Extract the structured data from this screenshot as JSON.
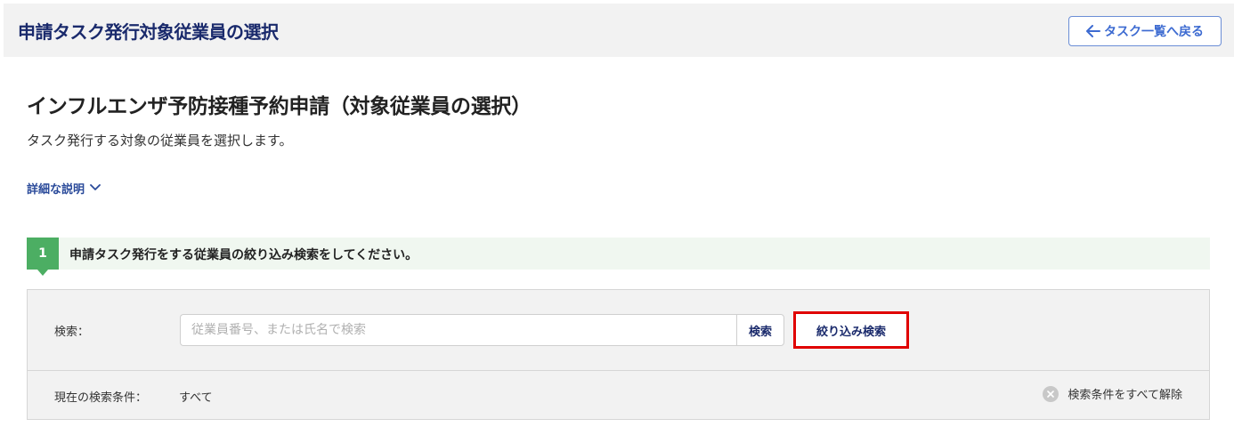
{
  "header": {
    "title": "申請タスク発行対象従業員の選択",
    "back_label": "タスク一覧へ戻る",
    "back_icon": "arrow-left-icon"
  },
  "main": {
    "title": "インフルエンザ予防接種予約申請（対象従業員の選択）",
    "description": "タスク発行する対象の従業員を選択します。",
    "detail_link": "詳細な説明",
    "detail_icon": "chevron-down-icon"
  },
  "step": {
    "number": "1",
    "text": "申請タスク発行をする従業員の絞り込み検索をしてください。"
  },
  "search": {
    "label": "検索：",
    "placeholder": "従業員番号、または氏名で検索",
    "value": "",
    "search_button": "検索",
    "filter_button": "絞り込み検索",
    "condition_label": "現在の検索条件：",
    "condition_value": "すべて",
    "clear_label": "検索条件をすべて解除",
    "clear_icon": "close-circle-icon"
  },
  "colors": {
    "header_title": "#1a2a6c",
    "accent_blue": "#3d6bd1",
    "step_green": "#4cae63",
    "highlight_red": "#e00000"
  }
}
